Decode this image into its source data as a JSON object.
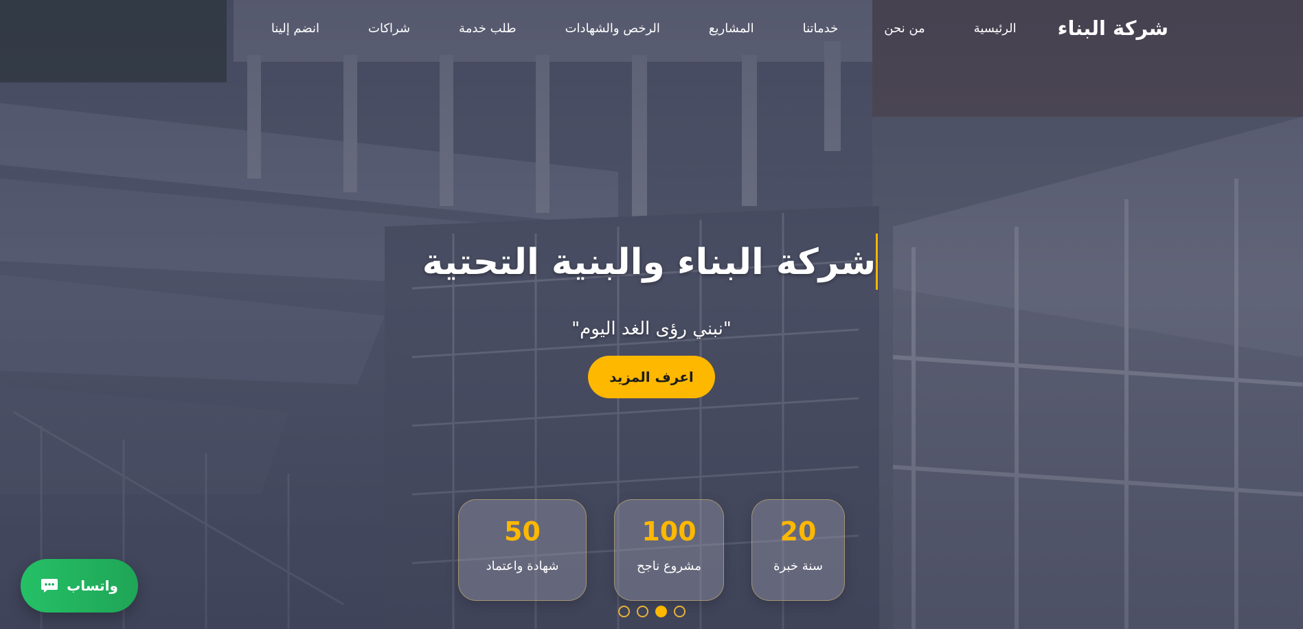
{
  "nav": {
    "brand": "شركة البناء",
    "links": [
      {
        "label": "الرئيسية"
      },
      {
        "label": "من نحن"
      },
      {
        "label": "خدماتنا"
      },
      {
        "label": "المشاريع"
      },
      {
        "label": "الرخص والشهادات"
      },
      {
        "label": "طلب خدمة"
      },
      {
        "label": "شراكات"
      },
      {
        "label": "انضم إلينا"
      }
    ]
  },
  "hero": {
    "title": "شركة البناء والبنية التحتية",
    "tagline": "\"نبني رؤى الغد اليوم\"",
    "cta_label": "اعرف المزيد"
  },
  "stats": [
    {
      "value": "20",
      "label": "سنة خبرة"
    },
    {
      "value": "100",
      "label": "مشروع ناجح"
    },
    {
      "value": "50",
      "label": "شهادة واعتماد"
    }
  ],
  "carousel": {
    "dot_count": 4,
    "active_index": 2
  },
  "whatsapp": {
    "label": "واتساب",
    "icon": "chat-bubble-icon"
  },
  "colors": {
    "accent": "#ffb800",
    "whatsapp": "#25c066",
    "text": "#ffffff"
  }
}
